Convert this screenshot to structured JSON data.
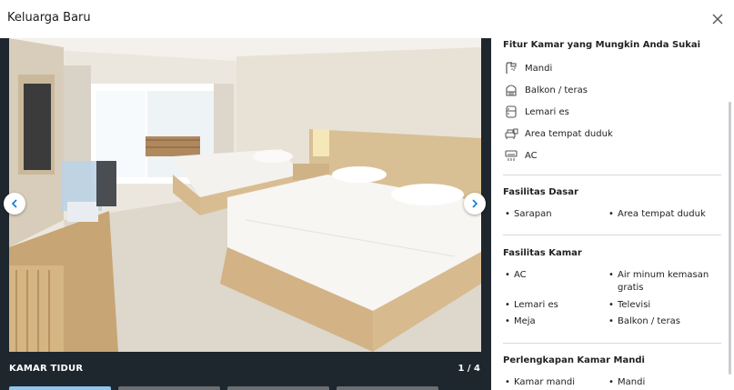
{
  "header": {
    "title": "Keluarga Baru"
  },
  "gallery": {
    "caption": "KAMAR TIDUR",
    "counter": "1 / 4"
  },
  "panel": {
    "features_title": "Fitur Kamar yang Mungkin Anda Sukai",
    "features": [
      {
        "icon": "shower-icon",
        "label": "Mandi"
      },
      {
        "icon": "balcony-icon",
        "label": "Balkon / teras"
      },
      {
        "icon": "fridge-icon",
        "label": "Lemari es"
      },
      {
        "icon": "sofa-icon",
        "label": "Area tempat duduk"
      },
      {
        "icon": "ac-icon",
        "label": "AC"
      }
    ],
    "basic_title": "Fasilitas Dasar",
    "basic_items": [
      "Sarapan",
      "Area tempat duduk"
    ],
    "room_title": "Fasilitas Kamar",
    "room_items": [
      "AC",
      "Air minum kemasan gratis",
      "Lemari es",
      "Televisi",
      "Meja",
      "Balkon / teras"
    ],
    "bath_title": "Perlengkapan Kamar Mandi",
    "bath_items": [
      "Kamar mandi",
      "Mandi"
    ]
  }
}
